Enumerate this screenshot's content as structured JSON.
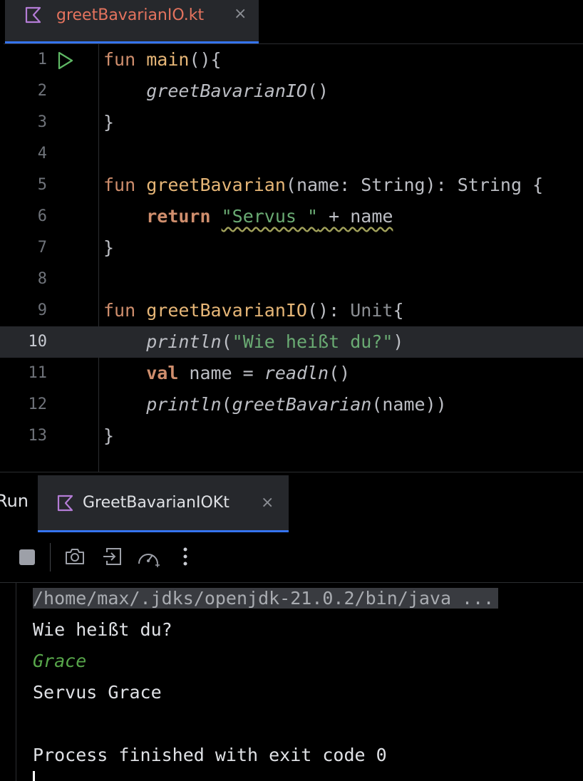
{
  "editor": {
    "tab": {
      "filename": "greetBavarianIO.kt",
      "close_glyph": "×",
      "icon": "kotlin-file-icon"
    },
    "current_line": 10,
    "line_numbers": [
      "1",
      "2",
      "3",
      "4",
      "5",
      "6",
      "7",
      "8",
      "9",
      "10",
      "11",
      "12",
      "13"
    ],
    "code": {
      "l1": {
        "kw": "fun",
        "name": "main",
        "rest": "(){"
      },
      "l2": {
        "call": "greetBavarianIO",
        "rest": "()"
      },
      "l3": {
        "text": "}"
      },
      "l5": {
        "kw": "fun",
        "name": "greetBavarian",
        "params": "(name: String): String {"
      },
      "l6": {
        "kw": "return",
        "str": "\"Servus \"",
        "rest": " + name"
      },
      "l7": {
        "text": "}"
      },
      "l9": {
        "kw": "fun",
        "name": "greetBavarianIO",
        "rest1": "(): ",
        "type": "Unit",
        "rest2": "{"
      },
      "l10": {
        "call": "println",
        "open": "(",
        "str": "\"Wie heißt du?\"",
        "close": ")"
      },
      "l11": {
        "kw": "val",
        "mid": " name = ",
        "call": "readln",
        "rest": "()"
      },
      "l12": {
        "call": "println",
        "open": "(",
        "call2": "greetBavarian",
        "rest": "(name))"
      },
      "l13": {
        "text": "}"
      }
    }
  },
  "run_panel": {
    "label": "Run",
    "tab": {
      "name": "GreetBavarianIOKt",
      "close_glyph": "×",
      "icon": "kotlin-file-icon"
    },
    "toolbar": [
      "stop-icon",
      "camera-icon",
      "exit-icon",
      "profiler-icon",
      "more-vert-icon"
    ],
    "console": {
      "command": "/home/max/.jdks/openjdk-21.0.2/bin/java ...",
      "prompt": "Wie heißt du?",
      "user_input": "Grace",
      "output": "Servus Grace",
      "exit": "Process finished with exit code 0"
    }
  },
  "colors": {
    "accent": "#3574f0",
    "keyword": "#cf8e6d",
    "function_decl": "#e6b677",
    "string": "#6aab73",
    "console_input": "#57a64a",
    "filename_tab": "#e4735e"
  }
}
